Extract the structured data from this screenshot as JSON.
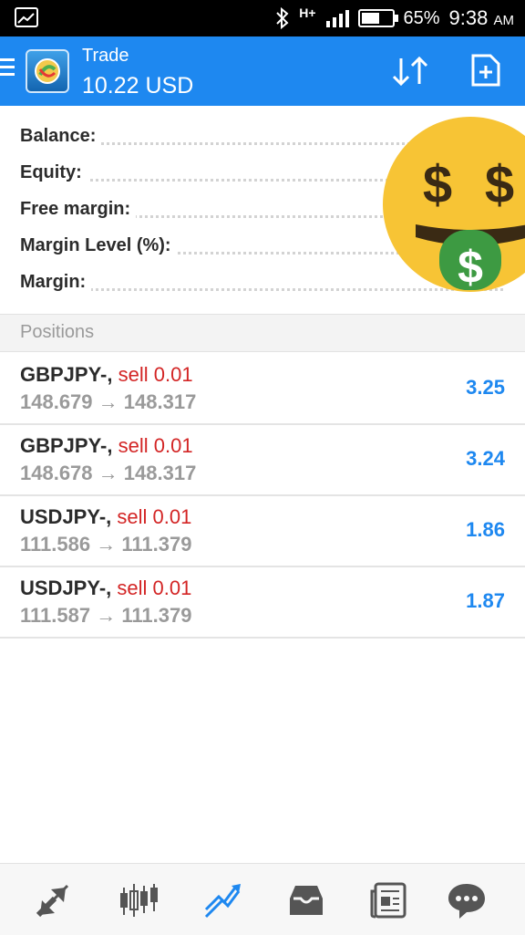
{
  "status_bar": {
    "network_type": "H+",
    "battery_percent": "65%",
    "battery_level": 0.65,
    "time": "9:38",
    "ampm": "AM"
  },
  "header": {
    "title": "Trade",
    "balance": "10.22 USD",
    "accent_color": "#1e88f0"
  },
  "account": [
    {
      "label": "Balance:"
    },
    {
      "label": "Equity:"
    },
    {
      "label": "Free margin:"
    },
    {
      "label": "Margin Level (%):"
    },
    {
      "label": "Margin:"
    }
  ],
  "positions": {
    "header": "Positions",
    "items": [
      {
        "symbol": "GBPJPY-,",
        "type": "sell 0.01",
        "open": "148.679",
        "arrow": "→",
        "current": "148.317",
        "profit": "3.25"
      },
      {
        "symbol": "GBPJPY-,",
        "type": "sell 0.01",
        "open": "148.678",
        "arrow": "→",
        "current": "148.317",
        "profit": "3.24"
      },
      {
        "symbol": "USDJPY-,",
        "type": "sell 0.01",
        "open": "111.586",
        "arrow": "→",
        "current": "111.379",
        "profit": "1.86"
      },
      {
        "symbol": "USDJPY-,",
        "type": "sell 0.01",
        "open": "111.587",
        "arrow": "→",
        "current": "111.379",
        "profit": "1.87"
      }
    ]
  },
  "nav": [
    {
      "icon": "quotes-icon",
      "active": false
    },
    {
      "icon": "chart-icon",
      "active": false
    },
    {
      "icon": "trade-icon",
      "active": true
    },
    {
      "icon": "history-icon",
      "active": false
    },
    {
      "icon": "news-icon",
      "active": false
    },
    {
      "icon": "chat-icon",
      "active": false
    }
  ],
  "overlay": {
    "icon": "money-mouth-face-icon"
  }
}
